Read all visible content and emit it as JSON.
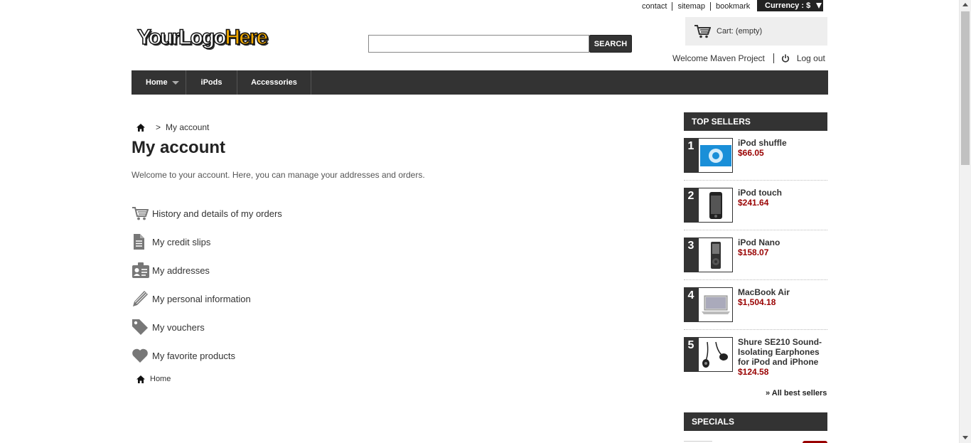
{
  "header": {
    "top_links": [
      "contact",
      "sitemap",
      "bookmark"
    ],
    "currency_label": "Currency : $",
    "logo": {
      "part1": "YourLogo",
      "part2": "Here"
    },
    "search": {
      "placeholder": "",
      "button_label": "SEARCH"
    },
    "cart": {
      "label": "Cart:",
      "status": "(empty)"
    },
    "welcome": "Welcome Maven Project",
    "logout": "Log out"
  },
  "nav": {
    "items": [
      "Home",
      "iPods",
      "Accessories"
    ]
  },
  "breadcrumb": {
    "separator": ">",
    "current": "My account"
  },
  "main": {
    "title": "My account",
    "intro": "Welcome to your account. Here, you can manage your addresses and orders.",
    "links": [
      {
        "label": "History and details of my orders",
        "icon": "cart-icon"
      },
      {
        "label": "My credit slips",
        "icon": "document-icon"
      },
      {
        "label": "My addresses",
        "icon": "address-card-icon"
      },
      {
        "label": "My personal information",
        "icon": "pencil-icon"
      },
      {
        "label": "My vouchers",
        "icon": "tag-icon"
      },
      {
        "label": "My favorite products",
        "icon": "heart-icon"
      }
    ],
    "footer_crumb": "Home"
  },
  "sidebar": {
    "top_sellers_title": "TOP SELLERS",
    "top_sellers": [
      {
        "rank": "1",
        "name": "iPod shuffle",
        "price": "$66.05"
      },
      {
        "rank": "2",
        "name": "iPod touch",
        "price": "$241.64"
      },
      {
        "rank": "3",
        "name": "iPod Nano",
        "price": "$158.07"
      },
      {
        "rank": "4",
        "name": "MacBook Air",
        "price": "$1,504.18"
      },
      {
        "rank": "5",
        "name": "Shure SE210 Sound-Isolating Earphones for iPod and iPhone",
        "price": "$124.58"
      }
    ],
    "all_best_sellers": "» All best sellers",
    "specials_title": "SPECIALS"
  },
  "colors": {
    "dark": "#333333",
    "price": "#990000",
    "logo_accent": "#f0a800",
    "cart_bg": "#eeeeee"
  }
}
